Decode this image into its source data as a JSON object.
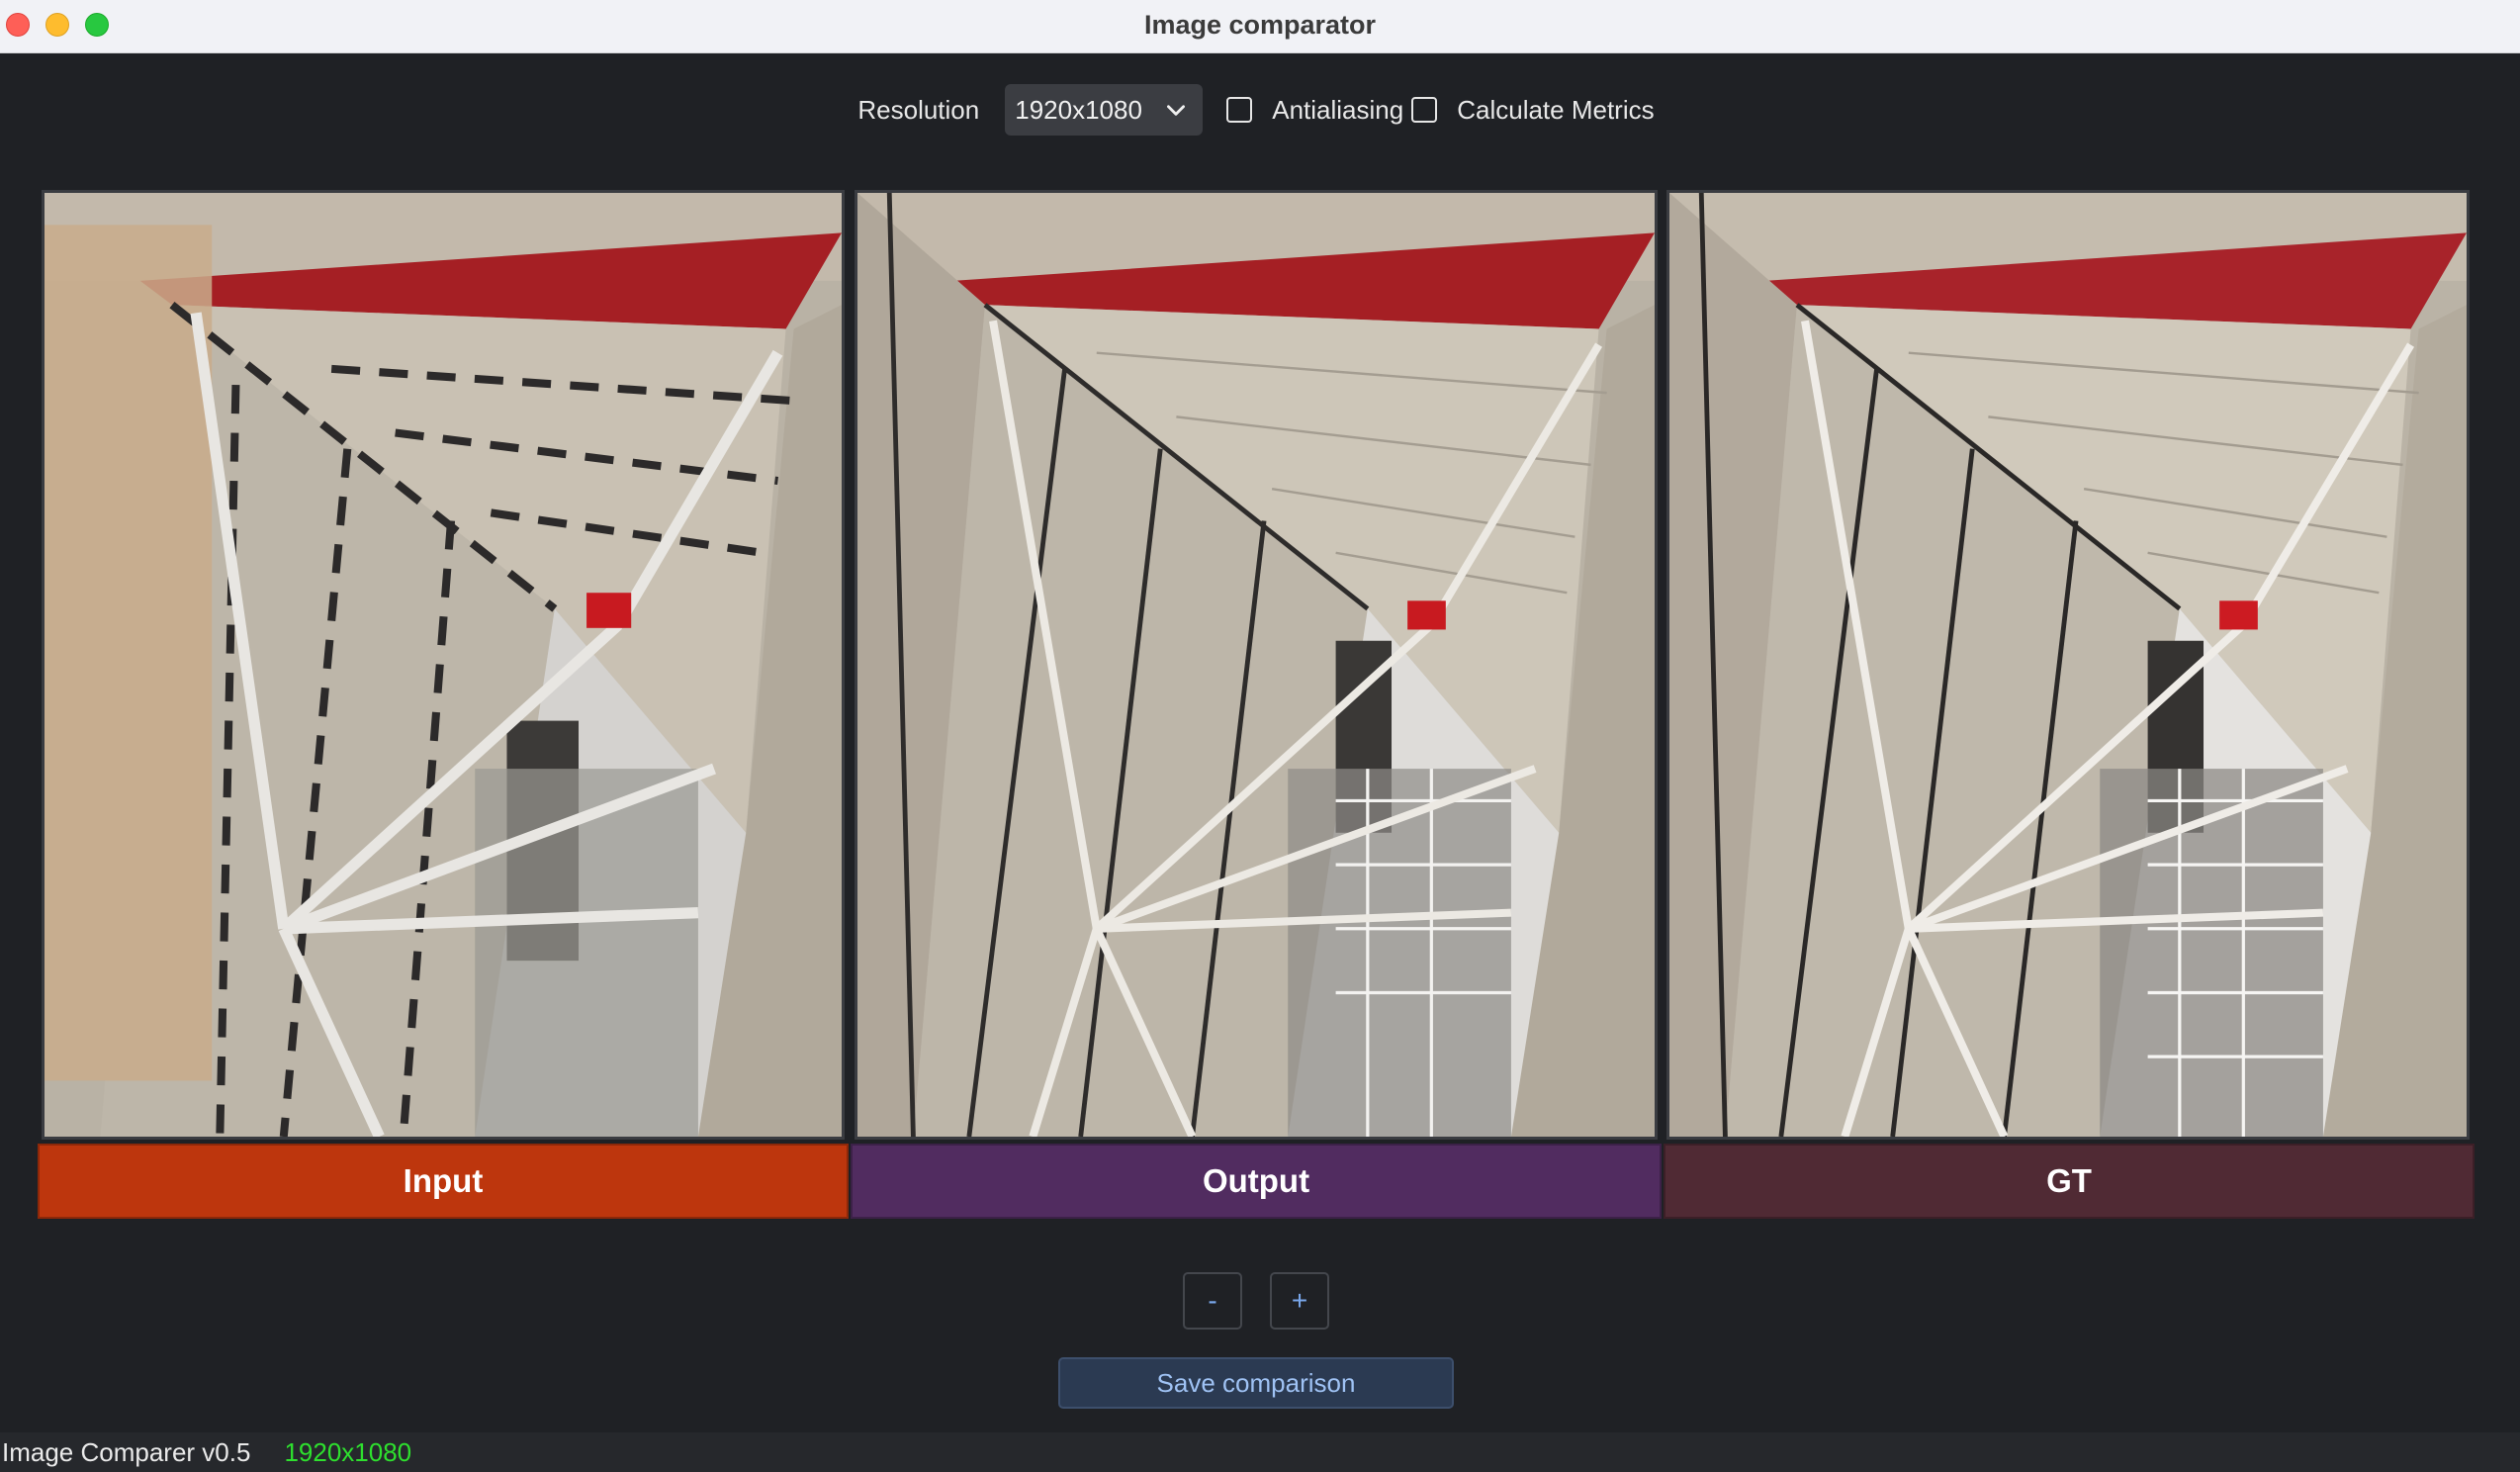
{
  "window": {
    "title": "Image comparator"
  },
  "toolbar": {
    "resolution_label": "Resolution",
    "resolution_value": "1920x1080",
    "antialiasing_label": "Antialiasing",
    "antialiasing_checked": false,
    "metrics_label": "Calculate Metrics",
    "metrics_checked": false
  },
  "panels": [
    {
      "label": "Input",
      "color": "#bd360d",
      "image": "building-interior-photo-pixelated"
    },
    {
      "label": "Output",
      "color": "#512c60",
      "image": "building-interior-photo"
    },
    {
      "label": "GT",
      "color": "#502a34",
      "image": "building-interior-photo"
    }
  ],
  "zoom": {
    "minus_label": "-",
    "plus_label": "+"
  },
  "save_label": "Save comparison",
  "status": {
    "app_version": "Image Comparer v0.5",
    "resolution": "1920x1080",
    "resolution_color": "#2ee02e"
  },
  "icons": {
    "dropdown": "chevron-down-icon"
  }
}
